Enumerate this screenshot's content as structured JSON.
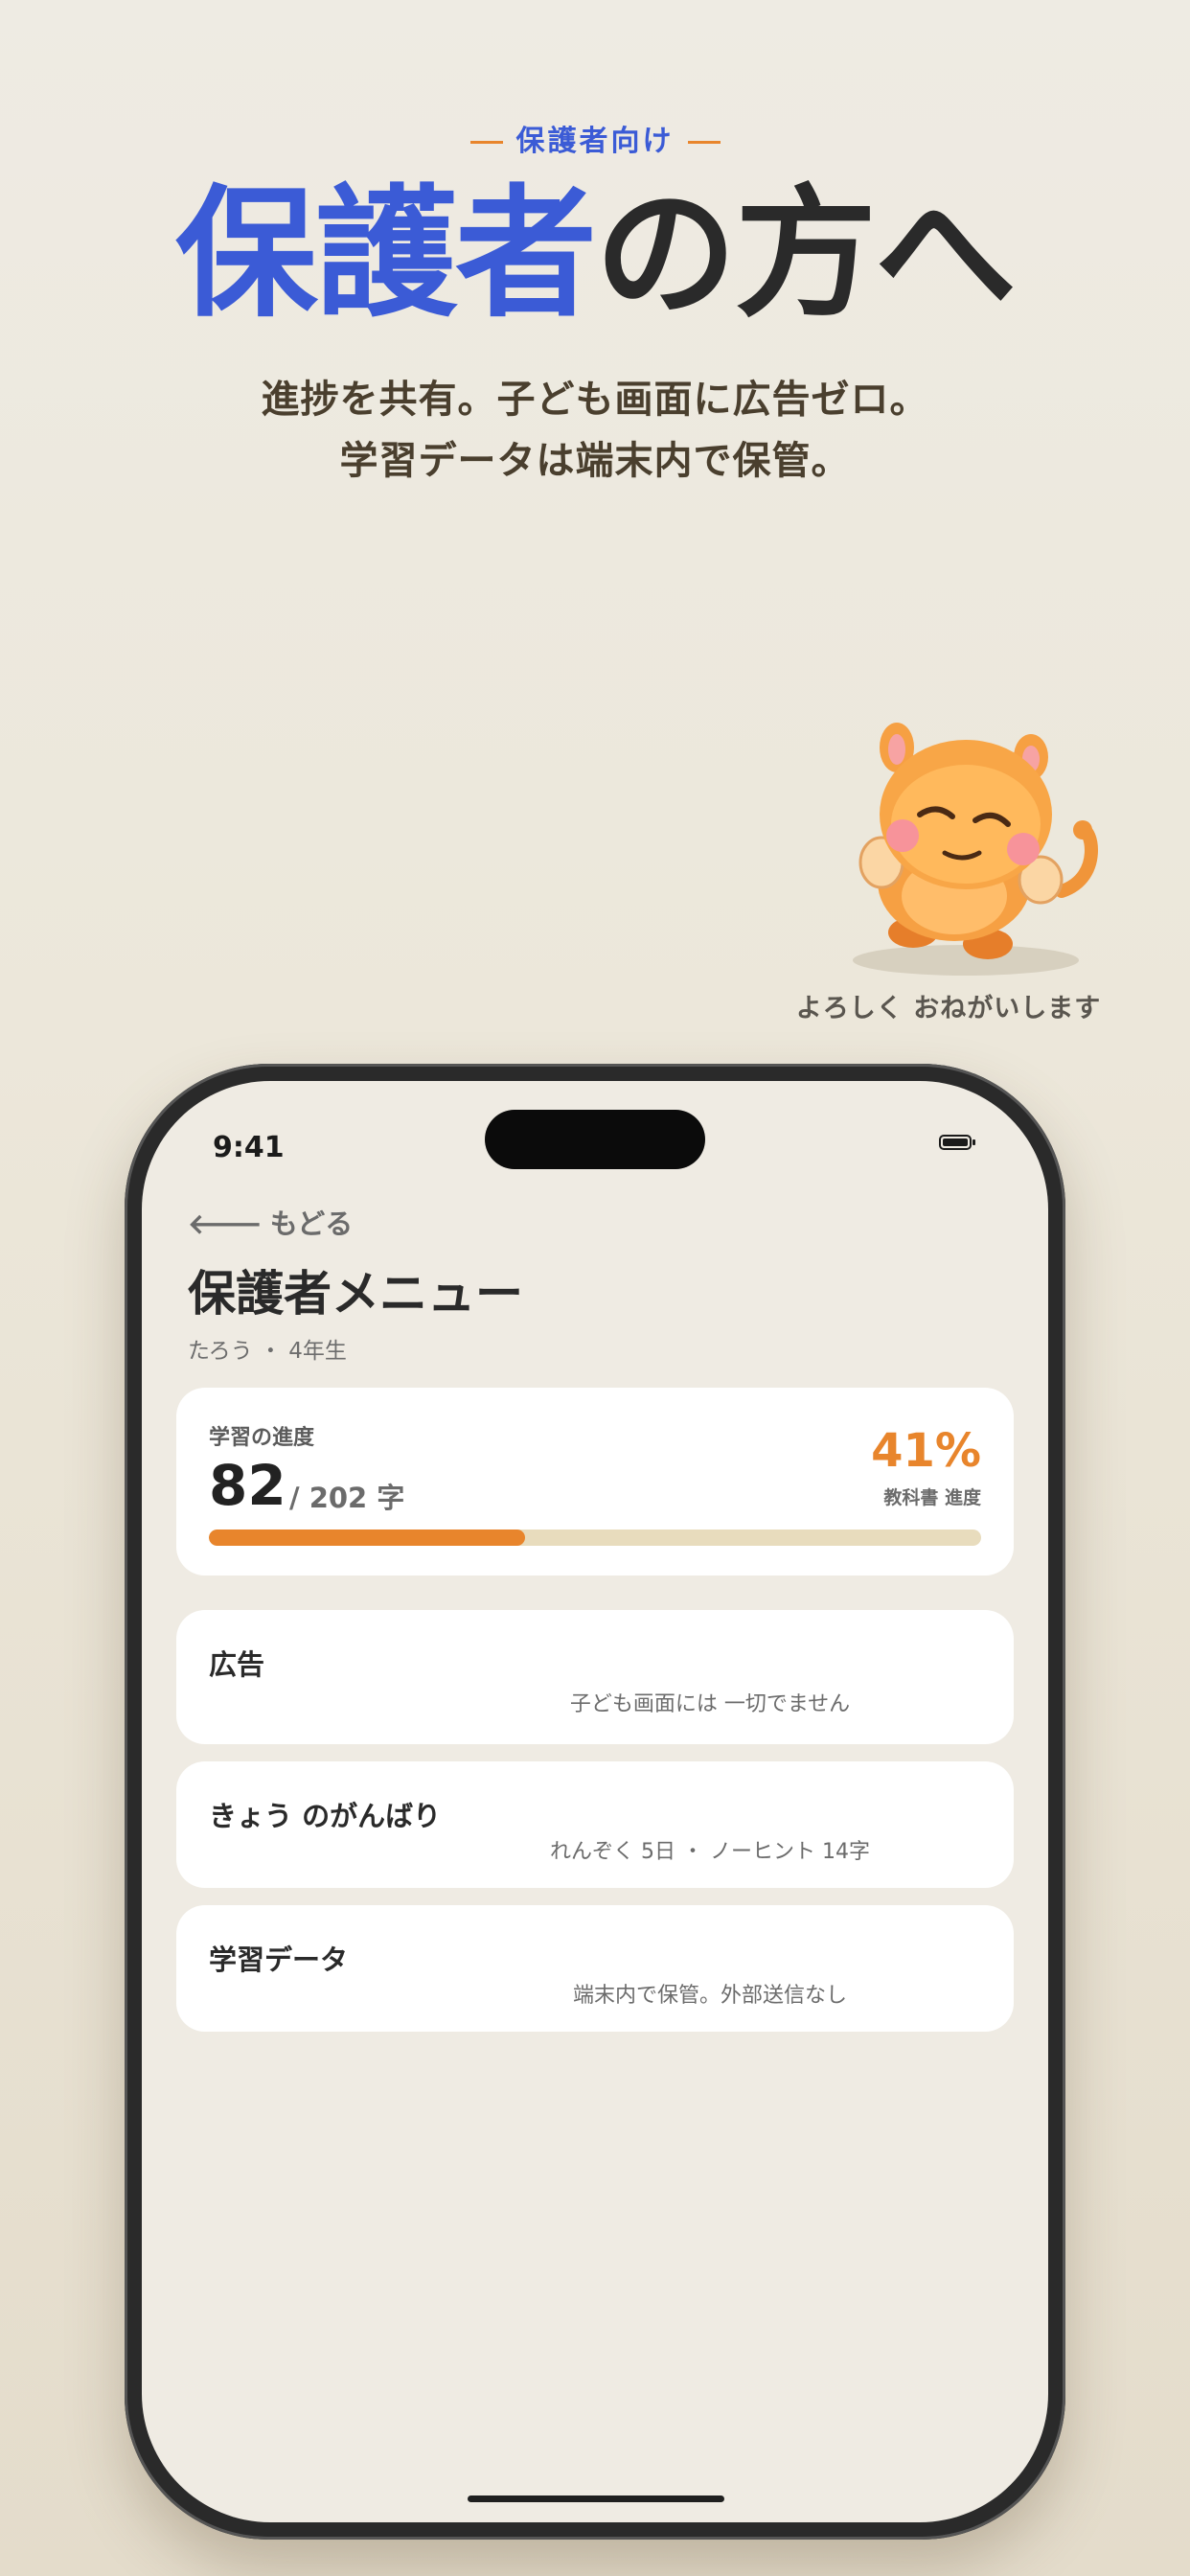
{
  "hero": {
    "eyebrow": "保護者向け",
    "headline_accent": "保護者",
    "headline_rest": "の方へ",
    "subline_1": "進捗を共有。子ども画面に広告ゼロ。",
    "subline_2": "学習データは端末内で保管。"
  },
  "mascot": {
    "caption": "よろしく おねがいします",
    "icon": "orange-monkey-mascot-icon"
  },
  "status_bar": {
    "time": "9:41",
    "battery_icon": "battery-icon"
  },
  "nav": {
    "back_label": "もどる",
    "back_icon": "arrow-left-icon"
  },
  "page": {
    "title": "保護者メニュー",
    "profile": "たろう ・ 4年生"
  },
  "progress": {
    "label": "学習の進度",
    "count": "82",
    "total": "/ 202 字",
    "percent": "41%",
    "percent_label": "教科書 進度",
    "fraction": 0.41
  },
  "menu": [
    {
      "title": "広告",
      "value": "子ども画面には 一切でません"
    },
    {
      "title": "きょう のがんばり",
      "value": "れんぞく 5日 ・ ノーヒント 14字"
    },
    {
      "title": "学習データ",
      "value": "端末内で保管。外部送信なし"
    }
  ],
  "colors": {
    "accent_blue": "#3b5bd6",
    "accent_orange": "#e8852c",
    "progress_track": "#e8dcbd"
  }
}
